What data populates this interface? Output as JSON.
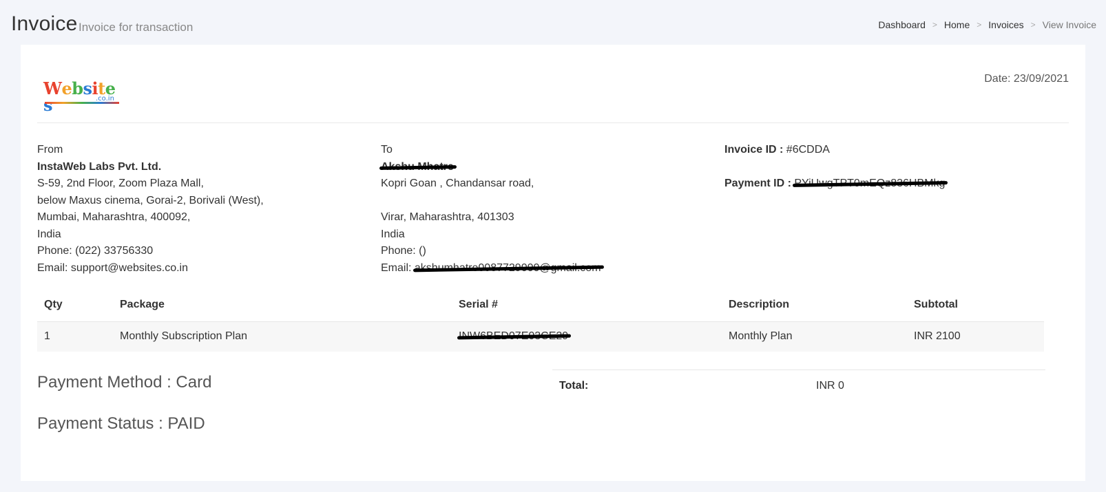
{
  "header": {
    "title": "Invoice",
    "subtitle": "Invoice for transaction",
    "breadcrumb": [
      "Dashboard",
      "Home",
      "Invoices",
      "View Invoice"
    ]
  },
  "logo": {
    "main": "Websites",
    "sub": ".co.in"
  },
  "date": "Date: 23/09/2021",
  "from": {
    "label": "From",
    "company": "InstaWeb Labs Pvt. Ltd.",
    "lines": [
      "S-59, 2nd Floor, Zoom Plaza Mall,",
      "below Maxus cinema, Gorai-2, Borivali (West),",
      "Mumbai, Maharashtra, 400092,",
      "India",
      "Phone: (022) 33756330",
      "Email: support@websites.co.in"
    ]
  },
  "to": {
    "label": "To",
    "name": "Akshu Mhatre",
    "address1": "Kopri Goan , Chandansar road,",
    "address2": "Virar, Maharashtra, 401303",
    "country": "India",
    "phone": "Phone: ()",
    "email_label": "Email: ",
    "email_value": "akshumhatre0087729000@gmail.com"
  },
  "invoice": {
    "id_label": "Invoice ID : ",
    "id_value": "#6CDDA",
    "payment_label": "Payment ID : ",
    "payment_value": "PYiUwgTPT0mEQz836HBMkg"
  },
  "table": {
    "headers": [
      "Qty",
      "Package",
      "Serial #",
      "Description",
      "Subtotal"
    ],
    "rows": [
      {
        "qty": "1",
        "package": "Monthly Subscription Plan",
        "serial": "INW6BED07E03CE29",
        "description": "Monthly Plan",
        "subtotal": "INR 2100"
      }
    ]
  },
  "payment": {
    "method": "Payment Method : Card",
    "status": "Payment Status : PAID"
  },
  "totals": {
    "label": "Total:",
    "value": "INR 0"
  },
  "colors": {
    "page_bg": "#f3f5fa",
    "card_bg": "#ffffff",
    "logo_colors": [
      "#e8432f",
      "#f2a12a",
      "#47b04b",
      "#2a7bd4"
    ]
  }
}
